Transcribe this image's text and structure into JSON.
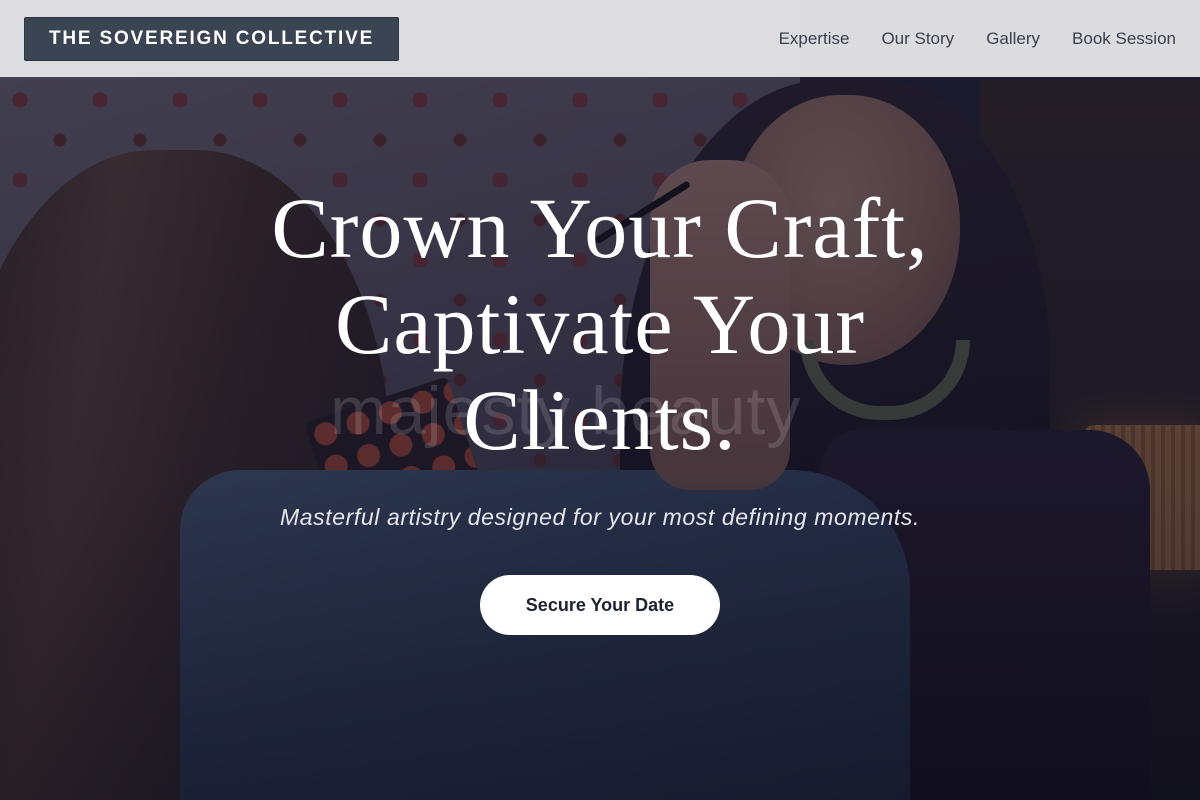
{
  "header": {
    "logo_text": "THE SOVEREIGN COLLECTIVE",
    "nav": [
      {
        "label": "Expertise"
      },
      {
        "label": "Our Story"
      },
      {
        "label": "Gallery"
      },
      {
        "label": "Book Session"
      }
    ]
  },
  "hero": {
    "headline_lines": [
      "Crown Your Craft,",
      "Captivate Your",
      "Clients."
    ],
    "subheadline": "Masterful artistry designed for your most defining moments.",
    "cta_label": "Secure Your Date",
    "watermark": "majesty beauty",
    "image_alt": "makeup artist applying eye makeup to a bride"
  },
  "colors": {
    "header_bg": "#e2e2e6",
    "logo_bg": "#3a4453",
    "cta_bg": "#ffffff",
    "cta_text": "#1f2230",
    "headline_text": "#ffffff"
  }
}
